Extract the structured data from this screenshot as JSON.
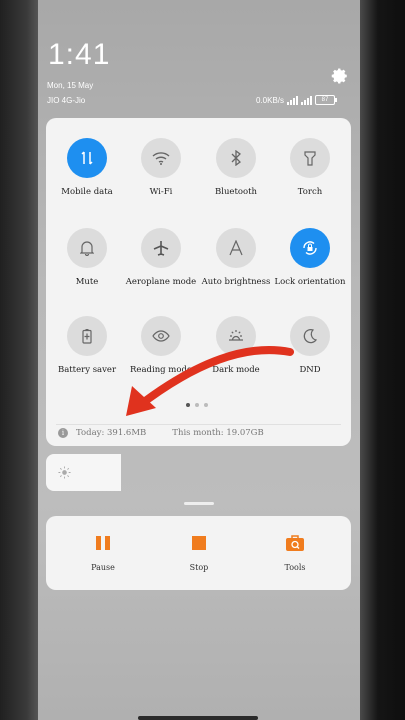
{
  "status": {
    "time": "1:41",
    "date": "Mon, 15 May",
    "carrier": "JIO 4G-Jio",
    "network_speed": "0.0KB/s",
    "battery": "87"
  },
  "quick_settings": {
    "tiles": [
      {
        "label": "Mobile data",
        "icon": "mobile-data-icon",
        "active": true
      },
      {
        "label": "Wi-Fi",
        "icon": "wifi-icon",
        "active": false
      },
      {
        "label": "Bluetooth",
        "icon": "bluetooth-icon",
        "active": false
      },
      {
        "label": "Torch",
        "icon": "torch-icon",
        "active": false
      },
      {
        "label": "Mute",
        "icon": "bell-icon",
        "active": false
      },
      {
        "label": "Aeroplane mode",
        "icon": "aeroplane-icon",
        "active": false
      },
      {
        "label": "Auto brightness",
        "icon": "auto-brightness-icon",
        "active": false
      },
      {
        "label": "Lock orientation",
        "icon": "lock-orientation-icon",
        "active": true
      },
      {
        "label": "Battery saver",
        "icon": "battery-saver-icon",
        "active": false
      },
      {
        "label": "Reading mode",
        "icon": "eye-icon",
        "active": false
      },
      {
        "label": "Dark mode",
        "icon": "dark-mode-icon",
        "active": false
      },
      {
        "label": "DND",
        "icon": "moon-icon",
        "active": false
      }
    ],
    "page_count": 3,
    "current_page": 1
  },
  "data_usage": {
    "today": "Today: 391.6MB",
    "month": "This month: 19.07GB"
  },
  "media_controls": {
    "pause_label": "Pause",
    "stop_label": "Stop",
    "tools_label": "Tools",
    "accent": "#f07c1e"
  },
  "colors": {
    "active_tile": "#1e8ff0",
    "annotation_arrow": "#e0321e"
  }
}
